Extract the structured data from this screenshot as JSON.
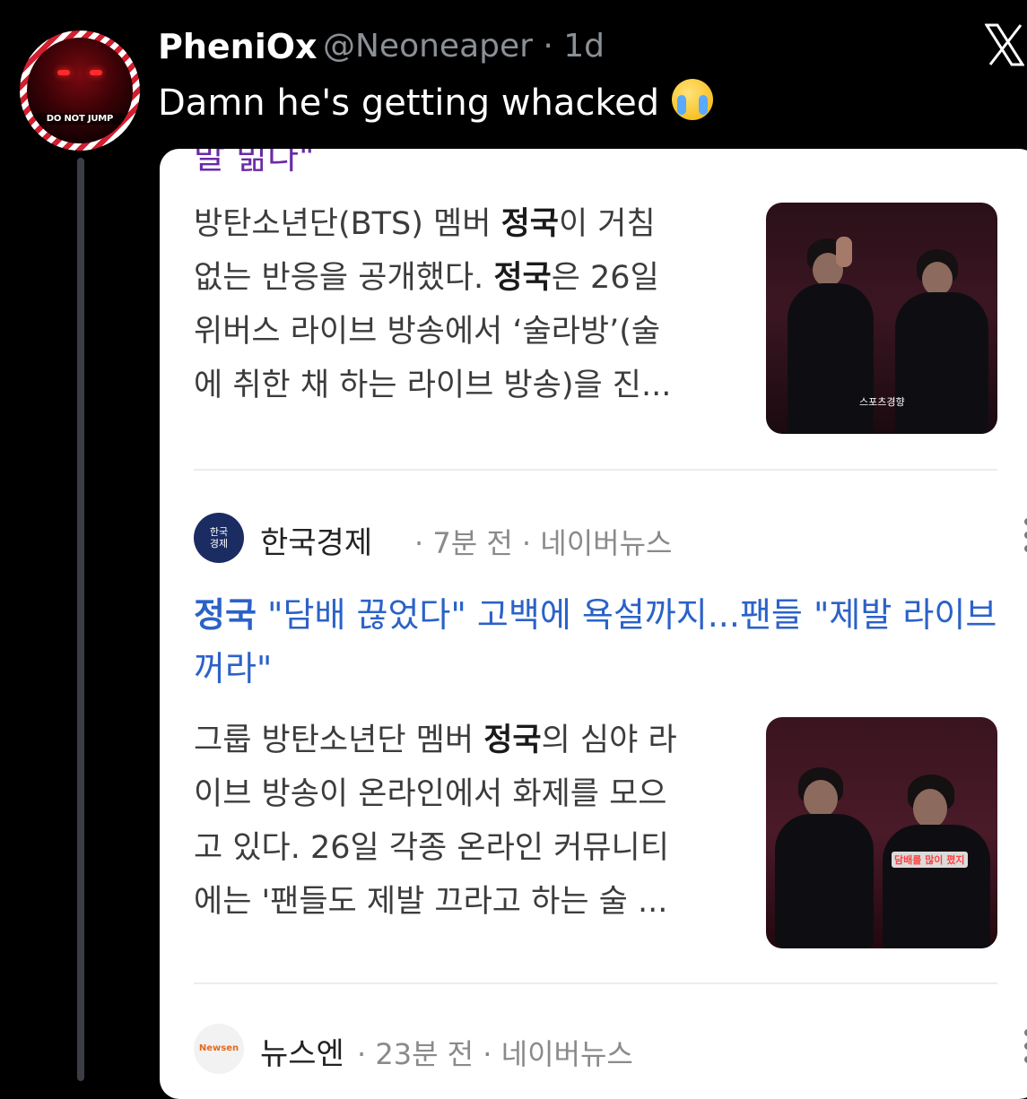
{
  "tweet": {
    "display_name": "PheniOx",
    "handle_time": "@Neoneaper · 1d",
    "text": "Damn he's getting whacked",
    "emoji": "loudly-crying-face",
    "avatar_badge": "DO NOT JUMP"
  },
  "article_1": {
    "title_fragment": "발 빎다\"",
    "snippet_lines": [
      [
        "방탄소년단(BTS) 멤버 ",
        "정국",
        "이 거침"
      ],
      [
        "없는 반응을 공개했다. ",
        "정국",
        "은 26일"
      ],
      [
        "위버스 라이브 방송에서 ‘술라방’(술",
        "",
        ""
      ],
      [
        "에 취한 채 하는 라이브 방송)을 진...",
        "",
        ""
      ]
    ],
    "thumb_caption": "스포츠경향"
  },
  "article_2": {
    "source_logo": "한국\n경제",
    "source": "한국경제",
    "meta": "· 7분 전 · 네이버뉴스",
    "headline_bold": "정국",
    "headline_rest": " \"담배 끊었다\" 고백에 욕설까지...팬들 \"제발 라이브 꺼라\"",
    "snippet_lines": [
      [
        "그룹 방탄소년단 멤버 ",
        "정국",
        "의 심야 라"
      ],
      [
        "이브 방송이 온라인에서 화제를 모으",
        "",
        ""
      ],
      [
        "고 있다. 26일 각종 온라인 커뮤니티",
        "",
        ""
      ],
      [
        "에는 '팬들도 제발 끄라고 하는 술 ...",
        "",
        ""
      ]
    ],
    "thumb_caption": "담배를 많이 폈지"
  },
  "article_3": {
    "source_logo": "Newsen",
    "source": "뉴스엔",
    "meta": "· 23분 전 · 네이버뉴스"
  },
  "colors": {
    "headline": "#2b62c8",
    "purple_title": "#6b2aa8",
    "background": "#000000"
  }
}
